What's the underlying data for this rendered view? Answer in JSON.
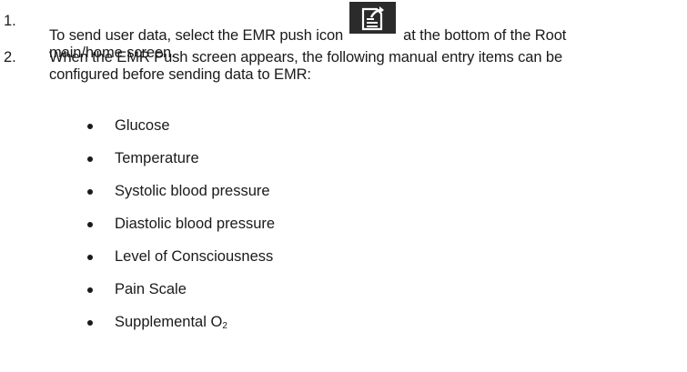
{
  "steps": [
    {
      "number": "1.",
      "line1_before_icon": "To send user data, select the EMR push icon",
      "icon": "emr-push-icon",
      "line1_after_icon": "at the bottom of the Root",
      "line2": "main/home screen."
    },
    {
      "number": "2.",
      "line1": "When the EMR Push screen appears, the following manual entry items can be",
      "line2": "configured before sending data to EMR:"
    }
  ],
  "items": [
    "Glucose",
    "Temperature",
    "Systolic blood pressure",
    "Diastolic blood pressure",
    "Level of Consciousness",
    "Pain Scale",
    "Supplemental O",
    "2"
  ],
  "colors": {
    "text": "#1a1a1a",
    "icon_background": "#2b2b2b",
    "icon_foreground": "#ffffff"
  }
}
